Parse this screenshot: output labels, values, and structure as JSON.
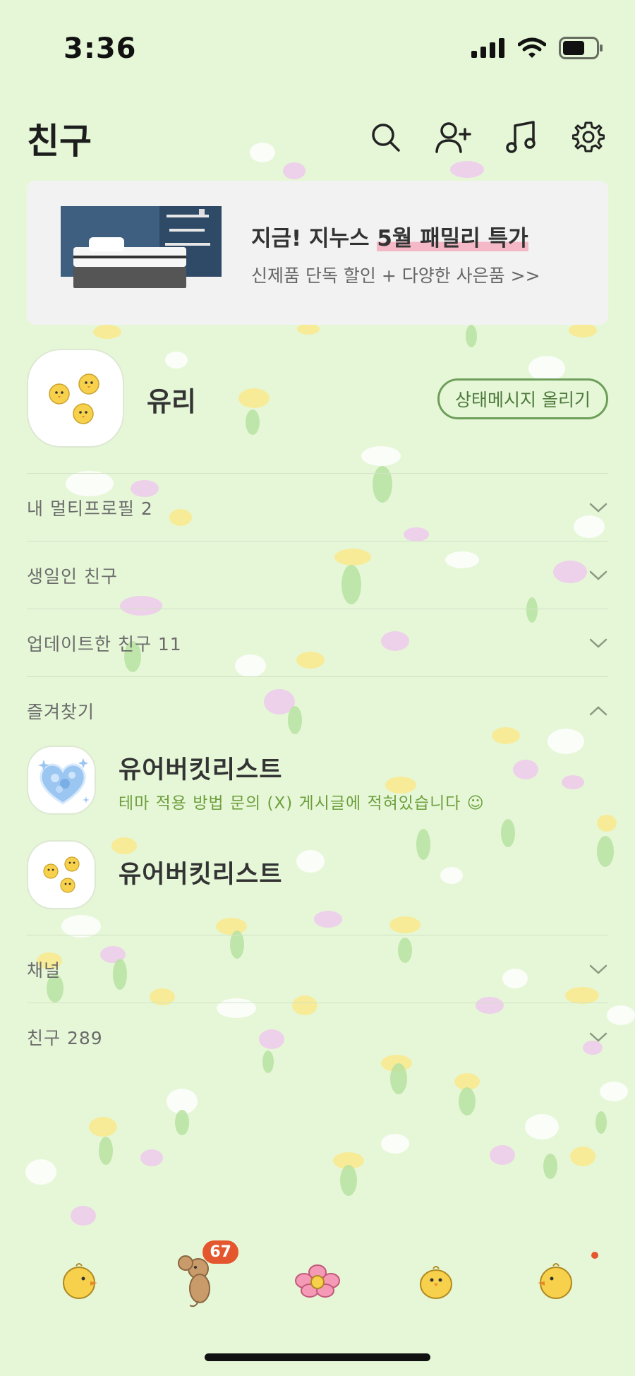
{
  "status_bar": {
    "time": "3:36"
  },
  "header": {
    "title": "친구"
  },
  "banner": {
    "title_prefix": "지금! 지누스 ",
    "title_highlight": "5월 패밀리 특가",
    "subtitle": "신제품 단독 할인 + 다양한 사은품 >>"
  },
  "profile": {
    "name": "유리",
    "status_button": "상태메시지 올리기"
  },
  "sections": {
    "multi_profile": "내 멀티프로필 2",
    "birthday": "생일인 친구",
    "updated": "업데이트한 친구 11",
    "favorites": "즐겨찾기",
    "channel": "채널",
    "friends": "친구 289"
  },
  "favorites": [
    {
      "name": "유어버킷리스트",
      "status": "테마 적용 방법 문의 (X) 게시글에 적혀있습니다 ☺"
    },
    {
      "name": "유어버킷리스트",
      "status": ""
    }
  ],
  "bottom_nav": {
    "badge": "67"
  },
  "colors": {
    "background": "#e6f7d8",
    "accent_green": "#6e9f5a",
    "badge_red": "#e4572e"
  }
}
